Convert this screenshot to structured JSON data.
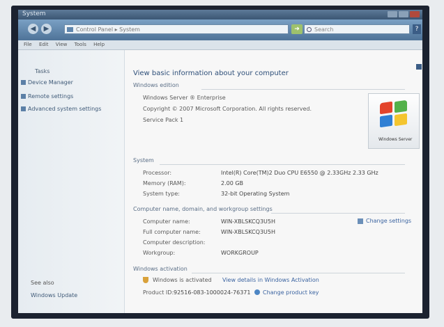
{
  "window": {
    "title": "System"
  },
  "toolbar": {
    "back_icon": "back-arrow-icon",
    "forward_icon": "forward-arrow-icon",
    "address": "Control Panel ▸ System",
    "search_placeholder": "Search",
    "help_icon": "?"
  },
  "menu": [
    "File",
    "Edit",
    "View",
    "Tools",
    "Help"
  ],
  "tasks": {
    "header": "Tasks",
    "items": [
      "Device Manager",
      "Remote settings",
      "Advanced system settings"
    ],
    "see_also_header": "See also",
    "see_also_item": "Windows Update"
  },
  "main": {
    "heading": "View basic information about your computer",
    "edition": {
      "section": "Windows edition",
      "name": "Windows Server ® Enterprise",
      "copyright": "Copyright © 2007 Microsoft Corporation.  All rights reserved.",
      "service_pack": "Service Pack 1"
    },
    "system": {
      "section": "System",
      "rows": [
        {
          "label": "Processor:",
          "value": "Intel(R) Core(TM)2 Duo CPU   E6550   @ 2.33GHz   2.33 GHz"
        },
        {
          "label": "Memory (RAM):",
          "value": "2.00 GB"
        },
        {
          "label": "System type:",
          "value": "32-bit Operating System"
        }
      ]
    },
    "computer_name": {
      "section": "Computer name, domain, and workgroup settings",
      "rows": [
        {
          "label": "Computer name:",
          "value": "WIN-XBLSKCQ3U5H"
        },
        {
          "label": "Full computer name:",
          "value": "WIN-XBLSKCQ3U5H"
        },
        {
          "label": "Computer description:",
          "value": ""
        },
        {
          "label": "Workgroup:",
          "value": "WORKGROUP"
        }
      ],
      "change_settings": "Change settings"
    },
    "activation": {
      "section": "Windows activation",
      "status": "Windows is activated",
      "status_link": "View details in Windows Activation",
      "product_id_label": "Product ID:",
      "product_id": "92516-083-1000024-76371",
      "change_key": "Change product key"
    },
    "logo_brand": "Windows Server"
  },
  "colors": {
    "link": "#3a63a0",
    "heading": "#2d4e78"
  }
}
